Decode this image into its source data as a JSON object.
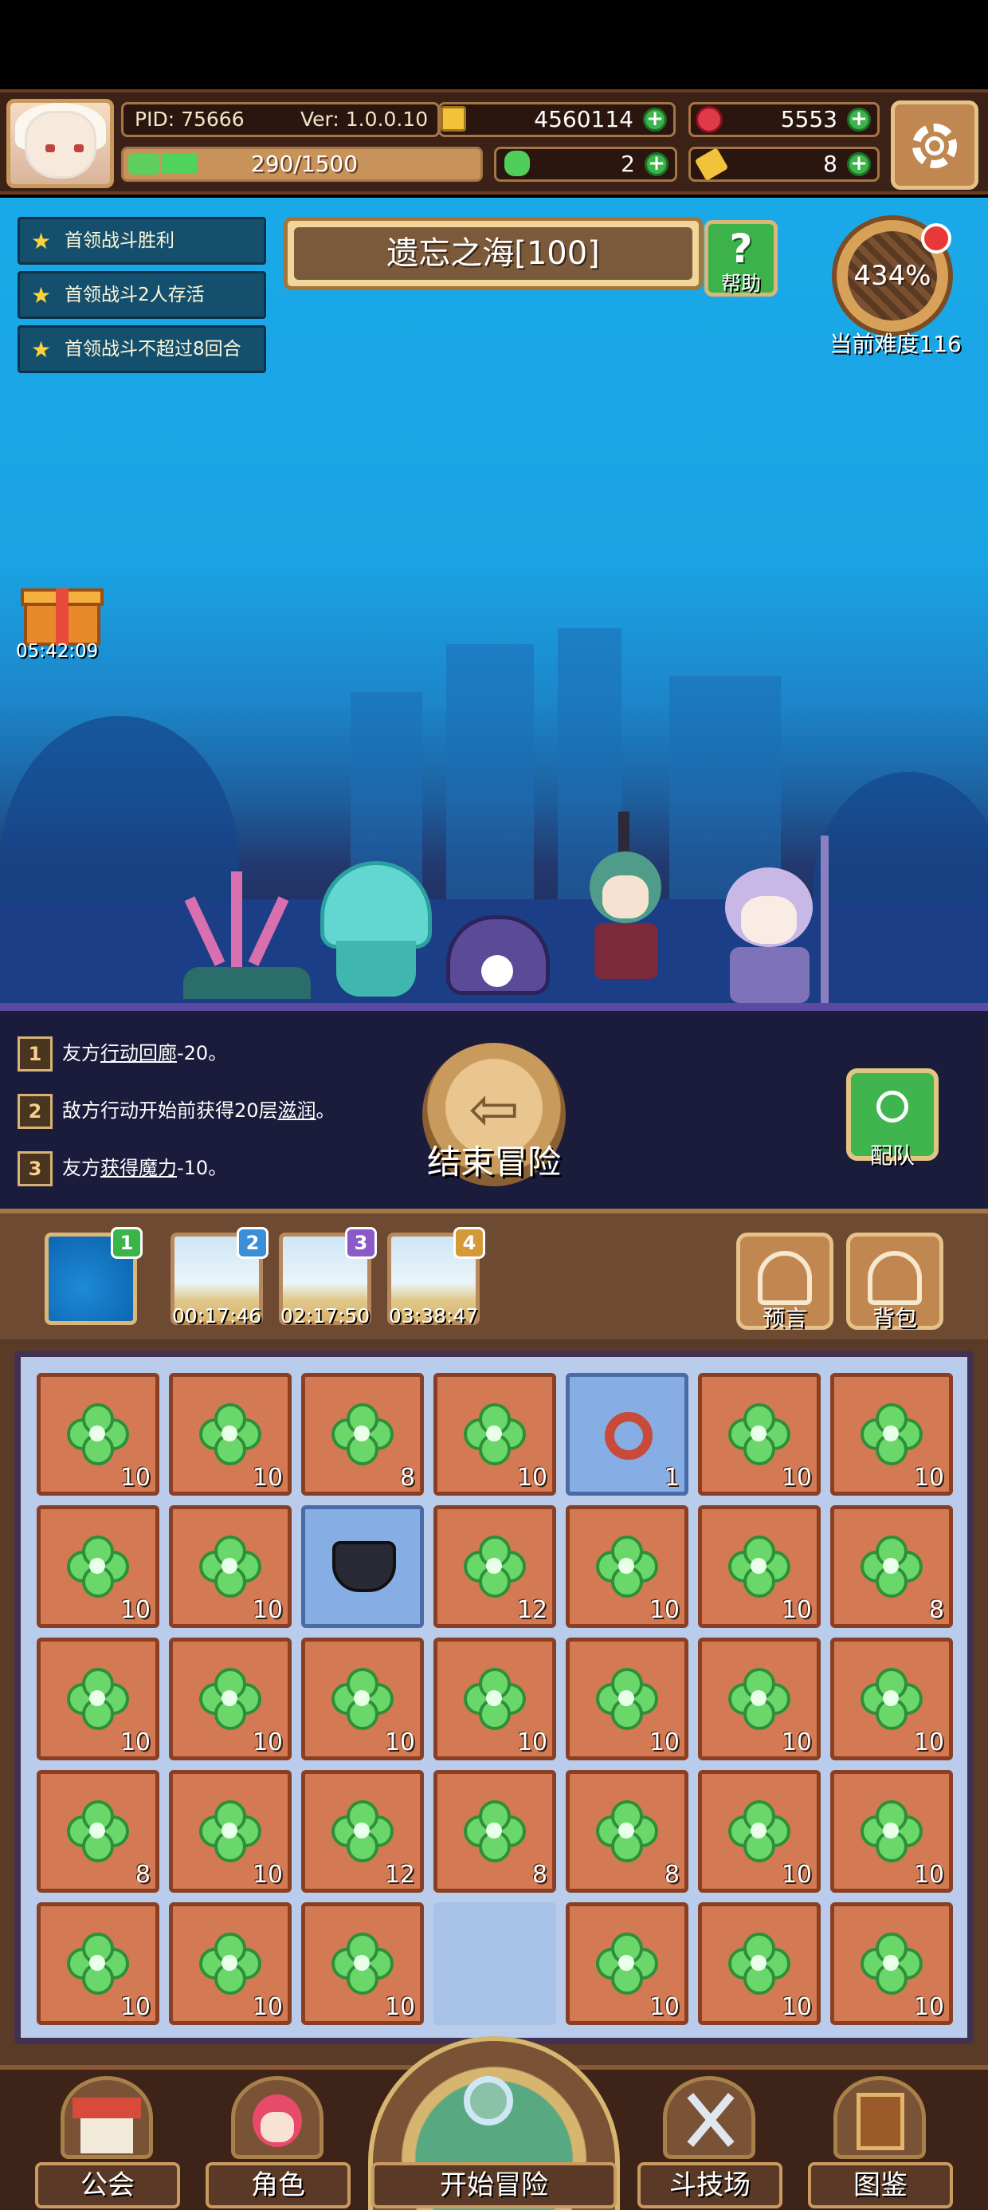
{
  "header": {
    "pid": "PID: 75666",
    "version": "Ver: 1.0.0.10",
    "gold": "4560114",
    "gems": "5553",
    "energy": "290/1500",
    "clovers": "2",
    "keys": "8"
  },
  "quests": [
    {
      "label": "首领战斗胜利"
    },
    {
      "label": "首领战斗2人存活"
    },
    {
      "label": "首领战斗不超过8回合"
    }
  ],
  "gift": {
    "timer": "05:42:09"
  },
  "map": {
    "title": "遗忘之海[100]",
    "help_label": "帮助",
    "help_glyph": "?"
  },
  "difficulty": {
    "percent": "434%",
    "label": "当前难度116"
  },
  "effects": [
    {
      "num": "1",
      "pre": "友方",
      "link": "行动回廊",
      "post": "-20。"
    },
    {
      "num": "2",
      "pre": "敌方行动开始前获得20层",
      "link": "滋润",
      "post": "。"
    },
    {
      "num": "3",
      "pre": "友方",
      "link": "获得魔力",
      "post": "-10。"
    }
  ],
  "actions": {
    "end_label": "结束冒险",
    "team_label": "配队"
  },
  "stages": [
    {
      "badge": "1",
      "time": "",
      "color": "#3bb54a"
    },
    {
      "badge": "2",
      "time": "00:17:46",
      "color": "#3a8fd8"
    },
    {
      "badge": "3",
      "time": "02:17:50",
      "color": "#8a5ac8"
    },
    {
      "badge": "4",
      "time": "03:38:47",
      "color": "#d49a3a"
    }
  ],
  "tools": {
    "prophecy_label": "预言",
    "backpack_label": "背包"
  },
  "inventory": {
    "rows": [
      [
        {
          "type": "clover",
          "count": "10"
        },
        {
          "type": "clover",
          "count": "10"
        },
        {
          "type": "clover",
          "count": "8"
        },
        {
          "type": "clover",
          "count": "10"
        },
        {
          "type": "ring",
          "count": "1"
        },
        {
          "type": "clover",
          "count": "10"
        },
        {
          "type": "clover",
          "count": "10"
        }
      ],
      [
        {
          "type": "clover",
          "count": "10"
        },
        {
          "type": "clover",
          "count": "10"
        },
        {
          "type": "cauldron",
          "count": ""
        },
        {
          "type": "clover",
          "count": "12"
        },
        {
          "type": "clover",
          "count": "10"
        },
        {
          "type": "clover",
          "count": "10"
        },
        {
          "type": "clover",
          "count": "8"
        }
      ],
      [
        {
          "type": "clover",
          "count": "10"
        },
        {
          "type": "clover",
          "count": "10"
        },
        {
          "type": "clover",
          "count": "10"
        },
        {
          "type": "clover",
          "count": "10"
        },
        {
          "type": "clover",
          "count": "10"
        },
        {
          "type": "clover",
          "count": "10"
        },
        {
          "type": "clover",
          "count": "10"
        }
      ],
      [
        {
          "type": "clover",
          "count": "8"
        },
        {
          "type": "clover",
          "count": "10"
        },
        {
          "type": "clover",
          "count": "12"
        },
        {
          "type": "clover",
          "count": "8"
        },
        {
          "type": "clover",
          "count": "8"
        },
        {
          "type": "clover",
          "count": "10"
        },
        {
          "type": "clover",
          "count": "10"
        }
      ],
      [
        {
          "type": "clover",
          "count": "10"
        },
        {
          "type": "clover",
          "count": "10"
        },
        {
          "type": "clover",
          "count": "10"
        },
        {
          "type": "empty",
          "count": ""
        },
        {
          "type": "clover",
          "count": "10"
        },
        {
          "type": "clover",
          "count": "10"
        },
        {
          "type": "clover",
          "count": "10"
        }
      ]
    ]
  },
  "nav": {
    "guild": "公会",
    "character": "角色",
    "adventure": "开始冒险",
    "arena": "斗技场",
    "codex": "图鉴"
  }
}
